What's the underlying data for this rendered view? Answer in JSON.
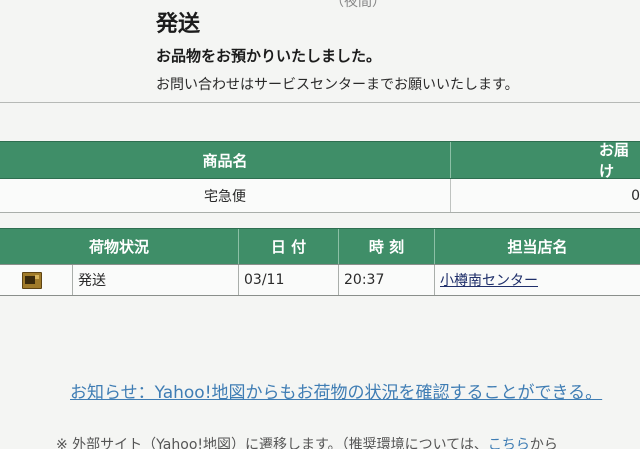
{
  "header": {
    "top_fragment": "（夜間）",
    "status_heading": "発送",
    "message_bold": "お品物をお預かりいたしました。",
    "message_normal": "お問い合わせはサービスセンターまでお願いいたします。"
  },
  "product_table": {
    "headers": {
      "name": "商品名",
      "delivery": "お届け"
    },
    "row": {
      "name": "宅急便",
      "delivery": "0"
    }
  },
  "status_table": {
    "headers": {
      "status": "荷物状況",
      "date": "日 付",
      "time": "時 刻",
      "store": "担当店名"
    },
    "rows": [
      {
        "icon": "package-icon",
        "status": "発送",
        "date": "03/11",
        "time": "20:37",
        "store": "小樽南センター"
      }
    ]
  },
  "notice": {
    "link_text": "お知らせ：Yahoo!地図からもお荷物の状況を確認することができる。"
  },
  "footnote": {
    "text": "※ 外部サイト（Yahoo!地図）に遷移します。（推奨環境については、",
    "link_text": "こちら",
    "tail": "から"
  },
  "colors": {
    "header_green": "#3f8e68",
    "link_blue": "#3f7db4",
    "store_link": "#1f2f6a"
  }
}
